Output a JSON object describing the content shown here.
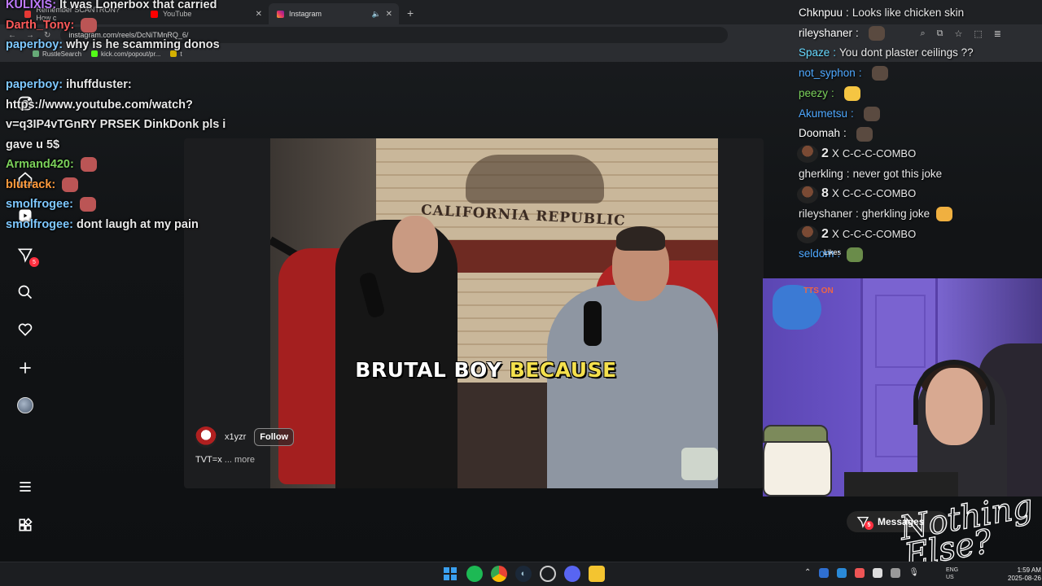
{
  "browser": {
    "tabs": [
      {
        "title": "Remember SCANTRON? How c",
        "color": "#e53935"
      },
      {
        "title": "YouTube",
        "color": "#ff0000"
      },
      {
        "title": "Instagram",
        "color": "#e1306c"
      }
    ],
    "new_tab": "+",
    "url": "instagram.com/reels/DcNiTMnRQ_6/",
    "bookmarks": [
      "RustleSearch",
      "kick.com/popout/pr...",
      "t"
    ]
  },
  "sidebar": {
    "notifications_badge": "5"
  },
  "reel": {
    "wall_sign": "CALIFORNIA REPUBLIC",
    "caption_white": "BRUTAL BOY",
    "caption_yellow": "BECAUSE",
    "username": "x1yzr",
    "follow_label": "Follow",
    "description": "TVT=x",
    "more_label": "... more",
    "likes_label": "Likes"
  },
  "chat_left": [
    {
      "user": "KULIXIS",
      "color": "#c07bff",
      "text": "It was Lonerbox that carried"
    },
    {
      "user": "Darth_Tony",
      "color": "#ff5a5a",
      "text": ""
    },
    {
      "user": "paperboy",
      "color": "#7ec8ff",
      "text": "why is he scamming donos"
    },
    {
      "user": "",
      "color": "#ffffff",
      "text": ""
    },
    {
      "user": "paperboy",
      "color": "#7ec8ff",
      "text": "ihuffduster:"
    },
    {
      "user": "",
      "color": "#ffffff",
      "text": "https://www.youtube.com/watch?"
    },
    {
      "user": "",
      "color": "#ffffff",
      "text": "v=q3IP4vTGnRY PRSEK DinkDonk pls i"
    },
    {
      "user": "",
      "color": "#ffffff",
      "text": "gave u 5$"
    },
    {
      "user": "Armand420",
      "color": "#7bd15a",
      "text": ""
    },
    {
      "user": "blutrack",
      "color": "#ff9b3d",
      "text": ""
    },
    {
      "user": "smolfrogee",
      "color": "#7ec8ff",
      "text": ""
    },
    {
      "user": "smolfrogee",
      "color": "#7ec8ff",
      "text": "dont laugh at my pain"
    }
  ],
  "chat_right": [
    {
      "user": "Chknpuu",
      "color": "#ffffff",
      "text": "Looks like chicken skin"
    },
    {
      "user": "rileyshaner",
      "color": "#ffffff",
      "text": ""
    },
    {
      "user": "Spaze",
      "color": "#66d9ff",
      "text": "You dont plaster ceilings ??"
    },
    {
      "user": "not_syphon",
      "color": "#4ea8ff",
      "text": ""
    },
    {
      "user": "peezy",
      "color": "#7bd15a",
      "text": ""
    },
    {
      "user": "Akumetsu",
      "color": "#4ea8ff",
      "text": ""
    },
    {
      "user": "Doomah",
      "color": "#ffffff",
      "text": ""
    }
  ],
  "combos": [
    {
      "count": "2",
      "x": "X",
      "label": "C-C-C-COMBO"
    },
    {
      "count": "8",
      "x": "X",
      "label": "C-C-C-COMBO"
    },
    {
      "count": "2",
      "x": "X",
      "label": "C-C-C-COMBO"
    }
  ],
  "chat_right_mid": [
    {
      "user": "gherkling",
      "color": "#ffffff",
      "text": "never got this joke"
    },
    {
      "user": "rileyshaner",
      "color": "#ffffff",
      "text": "gherkling joke"
    }
  ],
  "chat_right_last": {
    "user": "seldom",
    "color": "#4ea8ff",
    "text": ""
  },
  "webcam": {
    "tts_label": "TTS ON"
  },
  "messages": {
    "label": "Messages",
    "badge": "5"
  },
  "logo_text": "Nothing Else?",
  "taskbar": {
    "lang_top": "ENG",
    "lang_bottom": "US",
    "time": "1:59 AM",
    "date": "2025-08-26"
  }
}
